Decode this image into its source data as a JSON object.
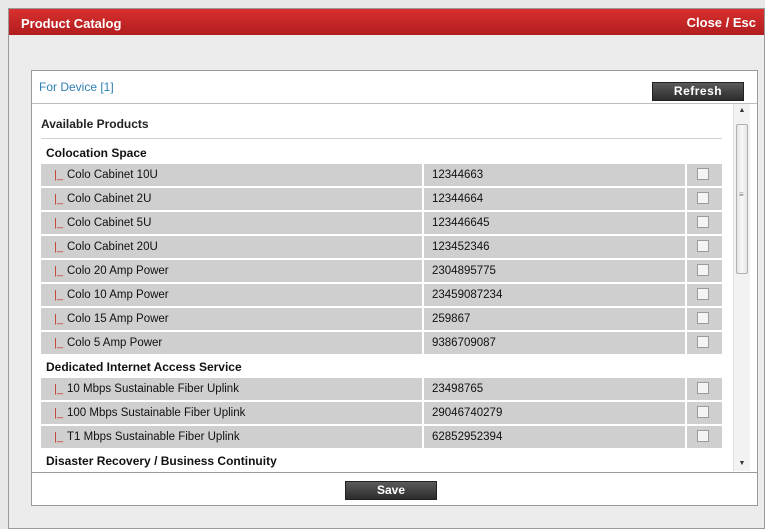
{
  "window": {
    "title": "Product Catalog",
    "close_label": "Close / Esc"
  },
  "panel": {
    "device_label": "For Device [1]",
    "refresh_label": "Refresh",
    "section_title": "Available Products",
    "save_label": "Save"
  },
  "categories": [
    {
      "name": "Colocation Space",
      "items": [
        {
          "name": "Colo Cabinet 10U",
          "code": "12344663",
          "checked": false
        },
        {
          "name": "Colo Cabinet 2U",
          "code": "12344664",
          "checked": false
        },
        {
          "name": "Colo Cabinet 5U",
          "code": "123446645",
          "checked": false
        },
        {
          "name": "Colo Cabinet 20U",
          "code": "123452346",
          "checked": false
        },
        {
          "name": "Colo 20 Amp Power",
          "code": "2304895775",
          "checked": false
        },
        {
          "name": "Colo 10 Amp Power",
          "code": "23459087234",
          "checked": false
        },
        {
          "name": "Colo 15 Amp Power",
          "code": "259867",
          "checked": false
        },
        {
          "name": "Colo 5 Amp Power",
          "code": "9386709087",
          "checked": false
        }
      ]
    },
    {
      "name": "Dedicated Internet Access Service",
      "items": [
        {
          "name": "10 Mbps Sustainable Fiber Uplink",
          "code": "23498765",
          "checked": false
        },
        {
          "name": "100 Mbps Sustainable Fiber Uplink",
          "code": "29046740279",
          "checked": false
        },
        {
          "name": "T1 Mbps Sustainable Fiber Uplink",
          "code": "62852952394",
          "checked": false
        }
      ]
    },
    {
      "name": "Disaster Recovery / Business Continuity",
      "items": []
    }
  ],
  "icons": {
    "tree_connector": "|_",
    "scroll_up": "▲",
    "scroll_down": "▼",
    "scroll_grip": "≡"
  },
  "colors": {
    "titlebar": "#c62828",
    "device_link": "#2e7fb5",
    "row_bg": "#cfcfcf",
    "tree_connector": "#c0392b"
  }
}
